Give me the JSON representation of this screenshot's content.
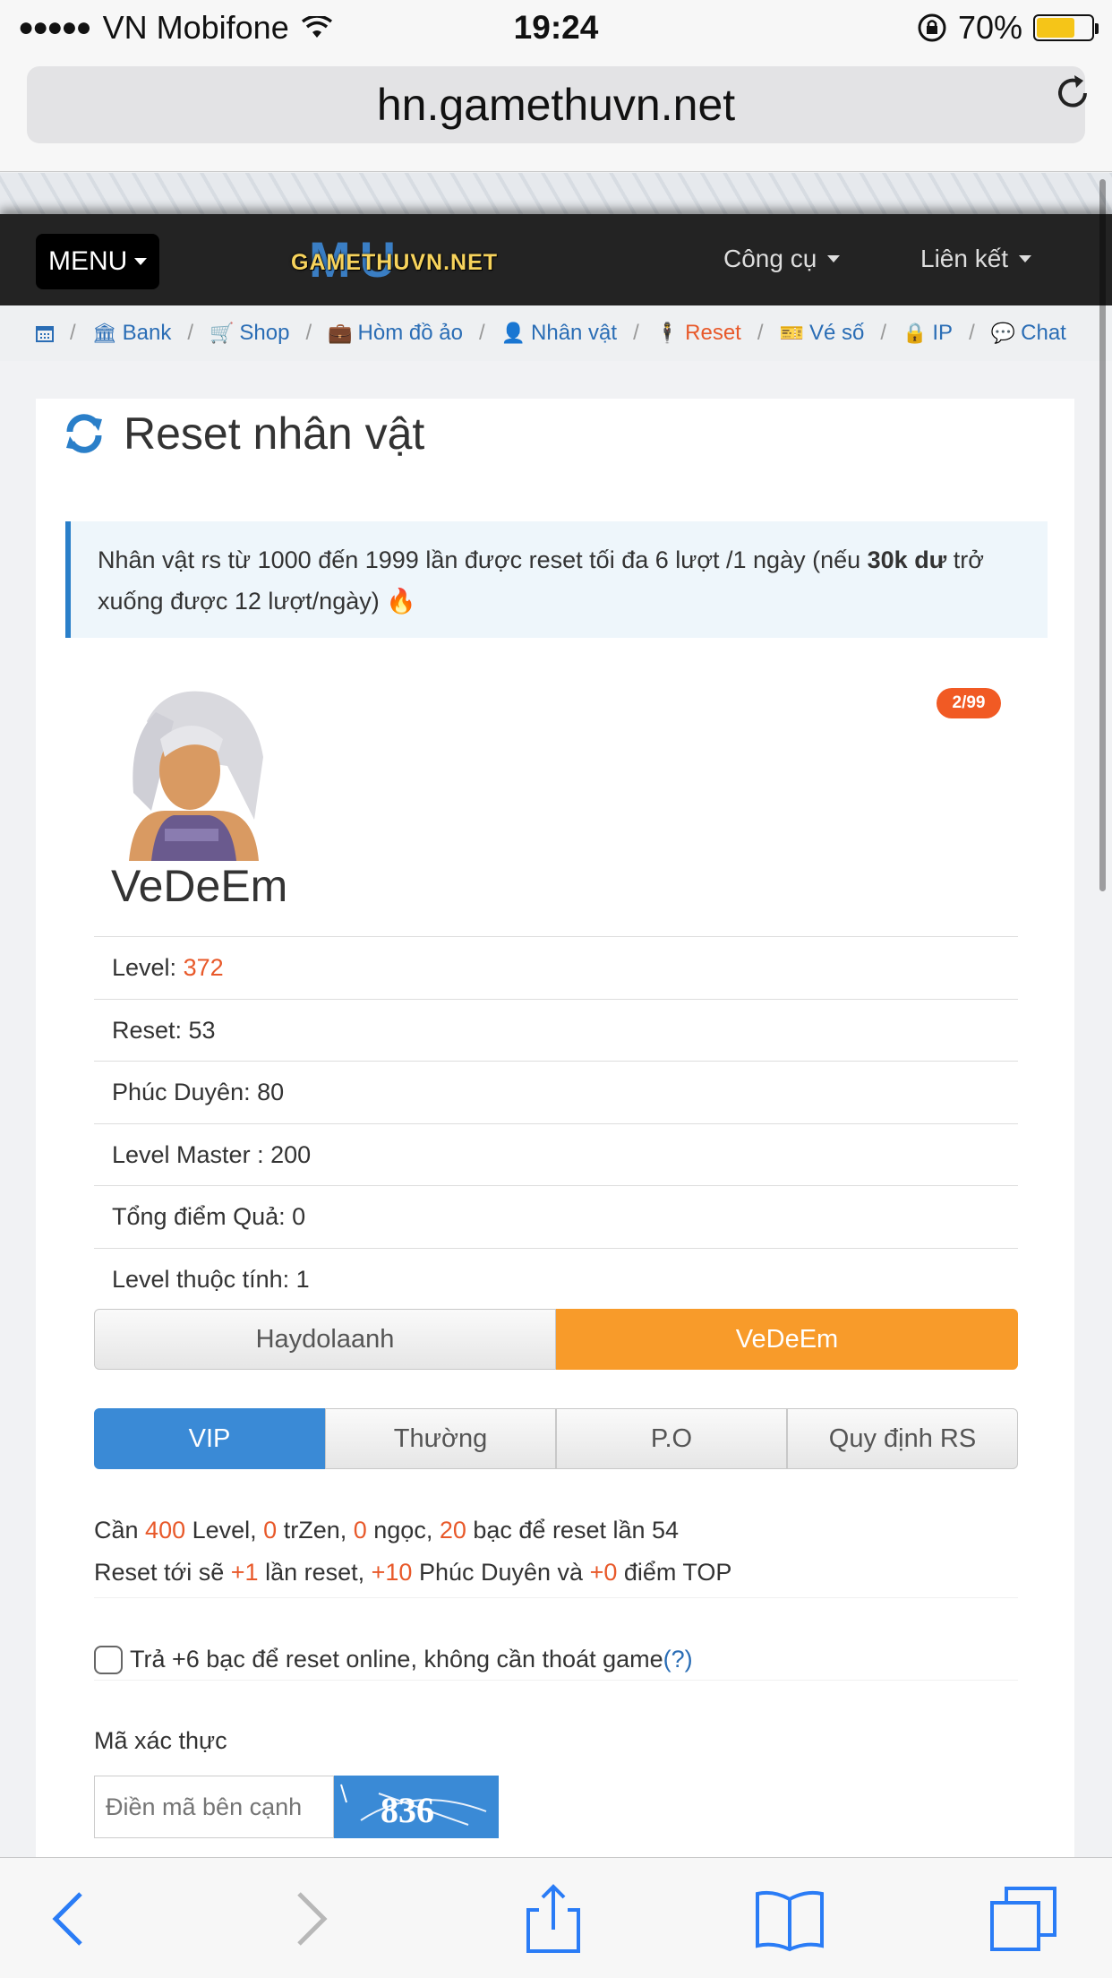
{
  "status_bar": {
    "carrier": "VN Mobifone",
    "time": "19:24",
    "battery": "70%",
    "battery_level": 0.7
  },
  "browser": {
    "url": "hn.gamethuvn.net"
  },
  "navbar": {
    "menu_label": "MENU",
    "logo_text": "GAMETHUVN.NET",
    "logo_bg_text": "MU",
    "tools_label": "Công cụ",
    "links_label": "Liên kết"
  },
  "breadcrumb": [
    {
      "label": "Bank",
      "icon": "bank-icon"
    },
    {
      "label": "Shop",
      "icon": "cart-icon"
    },
    {
      "label": "Hòm đồ ảo",
      "icon": "briefcase-icon"
    },
    {
      "label": "Nhân vật",
      "icon": "user-icon"
    },
    {
      "label": "Reset",
      "icon": "reset-user-icon"
    },
    {
      "label": "Vé số",
      "icon": "ticket-icon"
    },
    {
      "label": "IP",
      "icon": "lock-icon"
    },
    {
      "label": "Chat",
      "icon": "chat-icon"
    }
  ],
  "page": {
    "title": "Reset nhân vật",
    "notice_before": "Nhân vật rs từ 1000 đến 1999 lần được reset tối đa 6 lượt /1 ngày (nếu ",
    "notice_bold": "30k dư",
    "notice_after": " trở xuống được 12 lượt/ngày)"
  },
  "character": {
    "badge": "2/99",
    "name": "VeDeEm",
    "level_label": "Level: ",
    "level": "372",
    "reset": "Reset: 53",
    "phuc_duyen": "Phúc Duyên: 80",
    "level_master": "Level Master : 200",
    "tong_diem_qua": "Tổng điểm Quả: 0",
    "level_thuoc_tinh": "Level thuộc tính: 1"
  },
  "char_select": {
    "option_1": "Haydolaanh",
    "option_2": "VeDeEm"
  },
  "tabs": {
    "vip": "VIP",
    "thuong": "Thường",
    "po": "P.O",
    "quy_dinh": "Quy định RS"
  },
  "requirements": {
    "line1_a": "Cần ",
    "level": "400",
    "line1_b": " Level, ",
    "trzen": "0",
    "line1_c": " trZen, ",
    "ngoc": "0",
    "line1_d": " ngọc, ",
    "bac": "20",
    "line1_e": " bạc để reset lần 54",
    "line2_a": "Reset tới sẽ ",
    "reset_plus": "+1",
    "line2_b": " lần reset, ",
    "pd_plus": "+10",
    "line2_c": " Phúc Duyên và ",
    "top_plus": "+0",
    "line2_d": " điểm TOP"
  },
  "online_option": {
    "label": "Trả +6 bạc để reset online, không cần thoát game ",
    "help": "(?)"
  },
  "captcha": {
    "label": "Mã xác thực",
    "placeholder": "Điền mã bên cạnh",
    "image_text": "836"
  }
}
